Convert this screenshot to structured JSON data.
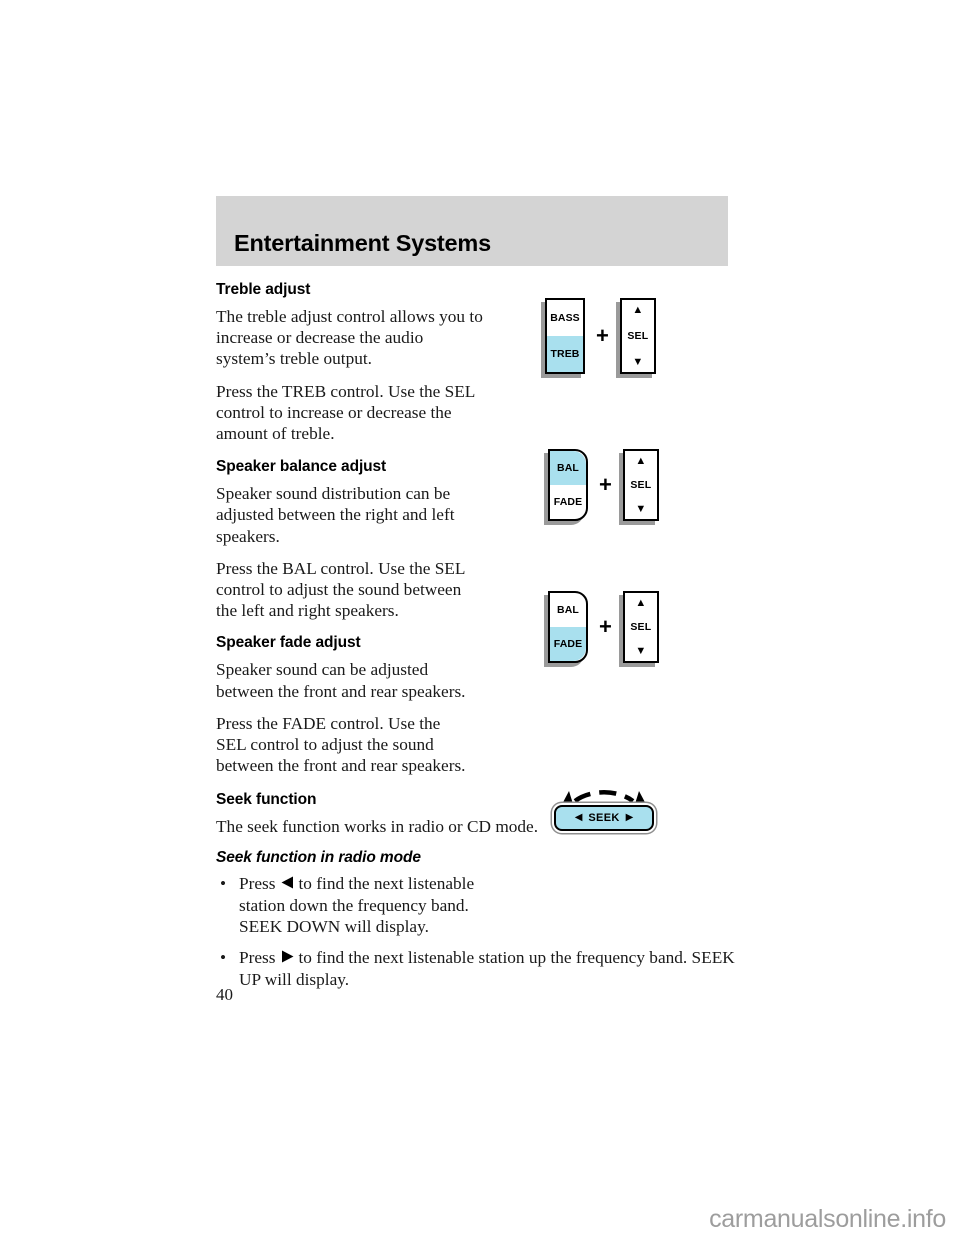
{
  "header": {
    "title": "Entertainment Systems"
  },
  "sections": [
    {
      "heading": "Treble adjust",
      "paragraphs": [
        "The treble adjust control allows you to increase or decrease the audio system’s treble output.",
        "Press the TREB control. Use the SEL control to increase or decrease the amount of treble."
      ]
    },
    {
      "heading": "Speaker balance adjust",
      "paragraphs": [
        "Speaker sound distribution can be adjusted between the right and left speakers.",
        "Press the BAL control. Use the SEL control to adjust the sound between the left and right speakers."
      ]
    },
    {
      "heading": "Speaker fade adjust",
      "paragraphs": [
        "Speaker sound can be adjusted between the front and rear speakers.",
        "Press the FADE control. Use the SEL control to adjust the sound between the front and rear speakers."
      ]
    },
    {
      "heading": "Seek function",
      "paragraphs": [
        "The seek function works in radio or CD mode."
      ],
      "subheading": "Seek function in radio mode"
    }
  ],
  "bullets": [
    {
      "bullet": "•",
      "text_before": "Press",
      "icon": "left-triangle",
      "text_after": "to find the next listenable station down the frequency band. SEEK DOWN will display."
    },
    {
      "bullet": "•",
      "text_before": "Press",
      "icon": "right-triangle",
      "text_after": "to find the next listenable station up the frequency band. SEEK UP will display."
    }
  ],
  "figures": {
    "treble": {
      "top_label": "BASS",
      "bottom_label": "TREB",
      "highlighted": "bottom",
      "operator": "+",
      "sel": {
        "up": "▲",
        "label": "SEL",
        "down": "▼"
      }
    },
    "balance": {
      "top_label": "BAL",
      "bottom_label": "FADE",
      "highlighted": "top",
      "operator": "+",
      "sel": {
        "up": "▲",
        "label": "SEL",
        "down": "▼"
      }
    },
    "fade": {
      "top_label": "BAL",
      "bottom_label": "FADE",
      "highlighted": "bottom",
      "operator": "+",
      "sel": {
        "up": "▲",
        "label": "SEL",
        "down": "▼"
      }
    },
    "seek": {
      "left_arrow": "◀",
      "label": "SEEK",
      "right_arrow": "▶"
    }
  },
  "footer": {
    "page_number": "40",
    "watermark": "carmanualsonline.info"
  },
  "colors": {
    "highlight": "#a9e0ee",
    "banner": "#d4d4d4",
    "outline": "#000000",
    "watermark": "#9d9d9d"
  }
}
